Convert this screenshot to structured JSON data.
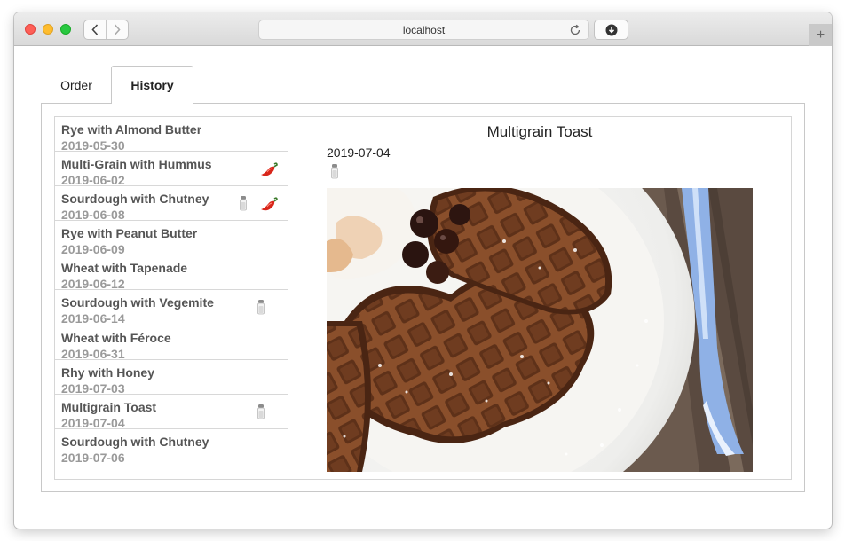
{
  "browser": {
    "address": "localhost",
    "new_tab_label": "+"
  },
  "tabs": [
    {
      "label": "Order",
      "selected": false
    },
    {
      "label": "History",
      "selected": true
    }
  ],
  "history": [
    {
      "title": "Rye with Almond Butter",
      "date": "2019-05-30",
      "icons": []
    },
    {
      "title": "Multi-Grain with Hummus",
      "date": "2019-06-02",
      "icons": [
        "chili-pepper-icon"
      ]
    },
    {
      "title": "Sourdough with Chutney",
      "date": "2019-06-08",
      "icons": [
        "salt-shaker-icon",
        "chili-pepper-icon"
      ]
    },
    {
      "title": "Rye with Peanut Butter",
      "date": "2019-06-09",
      "icons": []
    },
    {
      "title": "Wheat with Tapenade",
      "date": "2019-06-12",
      "icons": []
    },
    {
      "title": "Sourdough with Vegemite",
      "date": "2019-06-14",
      "icons": [
        "salt-shaker-icon"
      ]
    },
    {
      "title": "Wheat with Féroce",
      "date": "2019-06-31",
      "icons": []
    },
    {
      "title": "Rhy with Honey",
      "date": "2019-07-03",
      "icons": []
    },
    {
      "title": "Multigrain Toast",
      "date": "2019-07-04",
      "icons": [
        "salt-shaker-icon"
      ]
    },
    {
      "title": "Sourdough with Chutney",
      "date": "2019-07-06",
      "icons": []
    }
  ],
  "detail": {
    "title": "Multigrain Toast",
    "date": "2019-07-04",
    "icons": [
      "salt-shaker-icon"
    ],
    "photo": "waffle-on-plate-photo"
  },
  "colors": {
    "title_text": "#555555",
    "date_text": "#9a9a9a",
    "chili": "#d8261b",
    "salt_cap": "#8c8c8c"
  }
}
